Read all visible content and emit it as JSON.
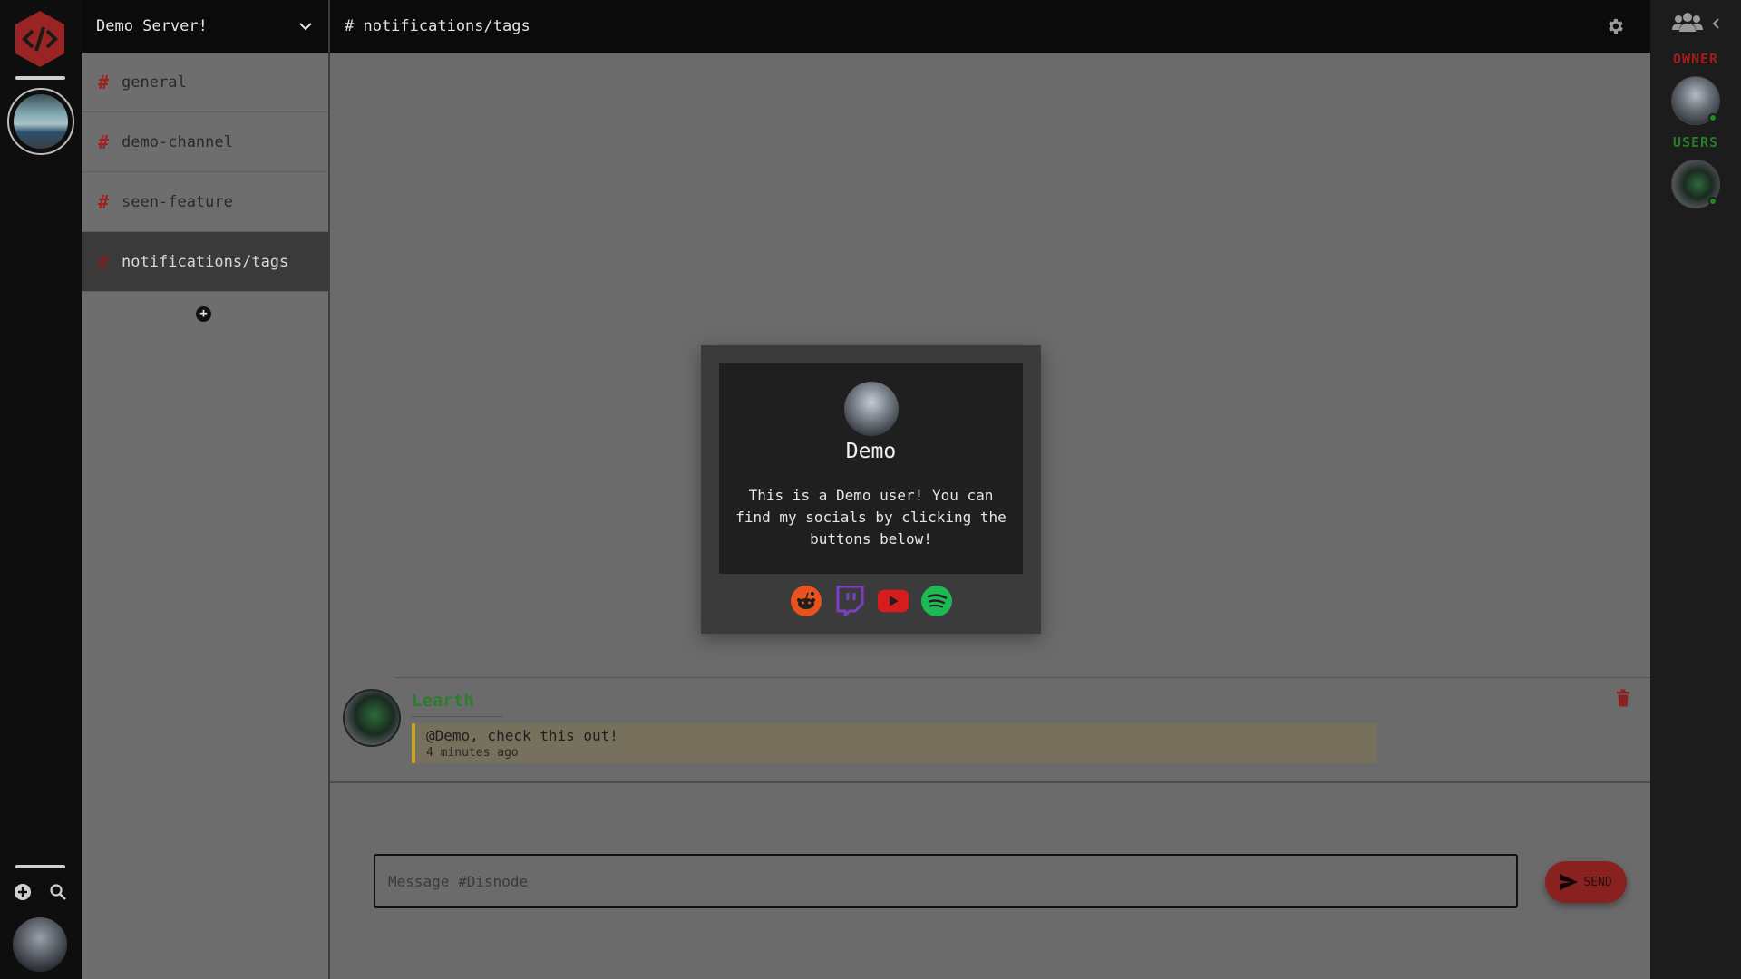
{
  "server": {
    "name": "Demo Server!"
  },
  "channels": [
    {
      "name": "general",
      "active": false
    },
    {
      "name": "demo-channel",
      "active": false
    },
    {
      "name": "seen-feature",
      "active": false
    },
    {
      "name": "notifications/tags",
      "active": true
    }
  ],
  "topbar": {
    "title": "# notifications/tags"
  },
  "message": {
    "author": "Learth",
    "text": "@Demo, check this out!",
    "time": "4 minutes ago"
  },
  "composer": {
    "placeholder": "Message #Disnode",
    "send_label": "SEND"
  },
  "members": {
    "owner_label": "OWNER",
    "users_label": "USERS"
  },
  "profile_modal": {
    "name": "Demo",
    "bio": "This is a Demo user! You can find my socials by clicking the buttons below!",
    "socials": [
      "reddit-icon",
      "twitch-icon",
      "youtube-icon",
      "spotify-icon"
    ]
  },
  "colors": {
    "accent_red": "#a31b1b",
    "online_green": "#1f8a1f",
    "mention_yellow": "#c8a520",
    "author_green": "#2e7d2e"
  }
}
